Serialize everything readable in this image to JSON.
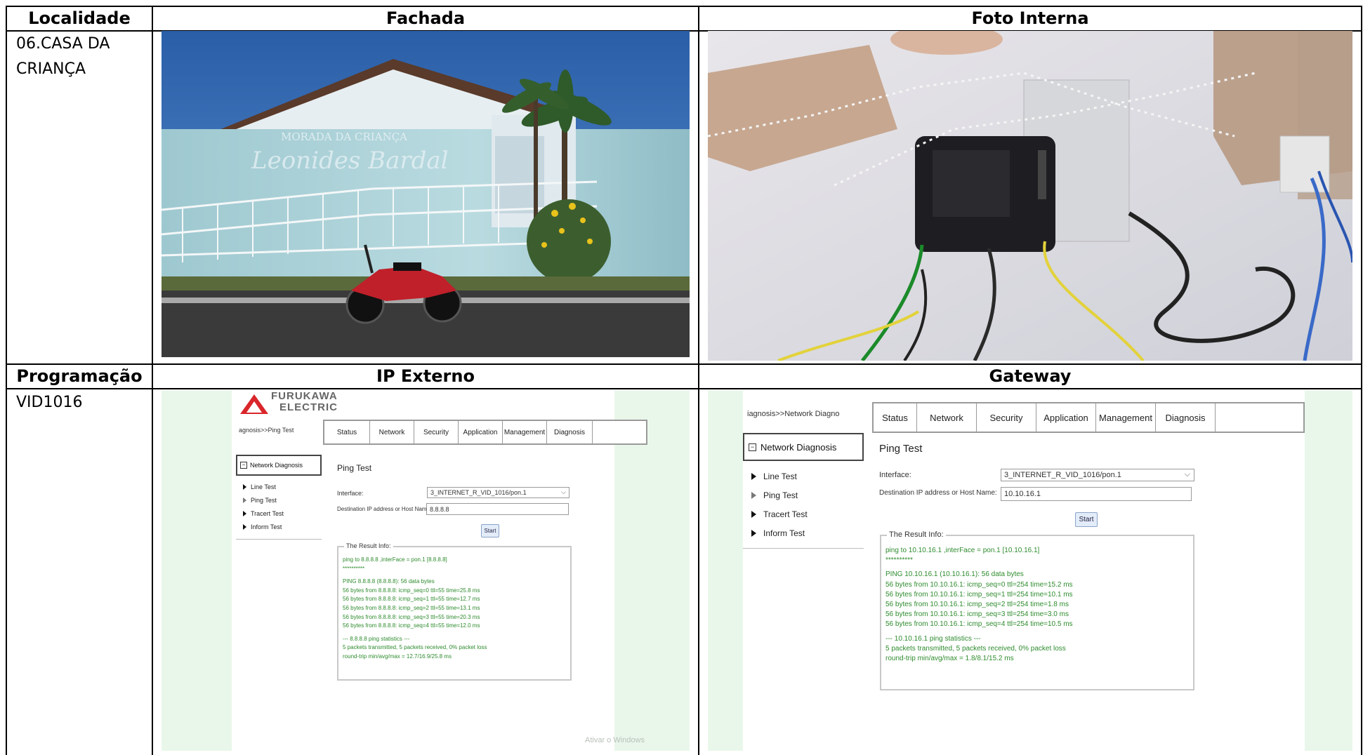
{
  "table": {
    "headers": {
      "localidade": "Localidade",
      "fachada": "Fachada",
      "foto_interna": "Foto Interna"
    },
    "row1": {
      "localidade_value": "06.CASA DA CRIANÇA"
    },
    "headers2": {
      "programacao": "Programação",
      "ip_externo": "IP Externo",
      "gateway": "Gateway"
    },
    "row2": {
      "programacao_value": "VID1016"
    }
  },
  "fachada_photo": {
    "sign_line1": "MORADA DA CRIANÇA",
    "sign_line2": "Leonides Bardal"
  },
  "ip_externo_shot": {
    "logo_text_1": "FURUKAWA",
    "logo_text_2": "ELECTRIC",
    "breadcrumb": "agnosis>>Ping Test",
    "tabs": [
      "Status",
      "Network",
      "Security",
      "Application",
      "Management",
      "Diagnosis"
    ],
    "nav_header": "Network Diagnosis",
    "nav_items": [
      "Line Test",
      "Ping Test",
      "Tracert Test",
      "Inform Test"
    ],
    "section_title": "Ping Test",
    "interface_label": "Interface:",
    "interface_value": "3_INTERNET_R_VID_1016/pon.1",
    "dest_label": "Destination IP address or Host Name:",
    "dest_value": "8.8.8.8",
    "start_label": "Start",
    "result_legend": "The Result Info:",
    "result_lines": [
      "ping to 8.8.8.8 ,interFace = pon.1 [8.8.8.8]",
      "**********",
      "",
      "PING 8.8.8.8 (8.8.8.8): 56 data bytes",
      "56 bytes from 8.8.8.8: icmp_seq=0 ttl=55 time=25.8 ms",
      "56 bytes from 8.8.8.8: icmp_seq=1 ttl=55 time=12.7 ms",
      "56 bytes from 8.8.8.8: icmp_seq=2 ttl=55 time=13.1 ms",
      "56 bytes from 8.8.8.8: icmp_seq=3 ttl=55 time=20.3 ms",
      "56 bytes from 8.8.8.8: icmp_seq=4 ttl=55 time=12.0 ms",
      "",
      "--- 8.8.8.8 ping statistics ---",
      "5 packets transmitted, 5 packets received, 0% packet loss",
      "round-trip min/avg/max = 12.7/16.9/25.8 ms"
    ],
    "watermark": "Ativar o Windows"
  },
  "gateway_shot": {
    "breadcrumb": "iagnosis>>Network Diagno",
    "tabs": [
      "Status",
      "Network",
      "Security",
      "Application",
      "Management",
      "Diagnosis"
    ],
    "nav_header": "Network Diagnosis",
    "nav_items": [
      "Line Test",
      "Ping Test",
      "Tracert Test",
      "Inform Test"
    ],
    "section_title": "Ping Test",
    "interface_label": "Interface:",
    "interface_value": "3_INTERNET_R_VID_1016/pon.1",
    "dest_label": "Destination IP address or Host Name:",
    "dest_value": "10.10.16.1",
    "start_label": "Start",
    "result_legend": "The Result Info:",
    "result_lines": [
      "ping to 10.10.16.1 ,interFace = pon.1 [10.10.16.1]",
      "**********",
      "",
      "PING 10.10.16.1 (10.10.16.1): 56 data bytes",
      "56 bytes from 10.10.16.1: icmp_seq=0 ttl=254 time=15.2 ms",
      "56 bytes from 10.10.16.1: icmp_seq=1 ttl=254 time=10.1 ms",
      "56 bytes from 10.10.16.1: icmp_seq=2 ttl=254 time=1.8 ms",
      "56 bytes from 10.10.16.1: icmp_seq=3 ttl=254 time=3.0 ms",
      "56 bytes from 10.10.16.1: icmp_seq=4 ttl=254 time=10.5 ms",
      "",
      "--- 10.10.16.1 ping statistics ---",
      "5 packets transmitted, 5 packets received, 0% packet loss",
      "round-trip min/avg/max = 1.8/8.1/15.2 ms"
    ]
  }
}
